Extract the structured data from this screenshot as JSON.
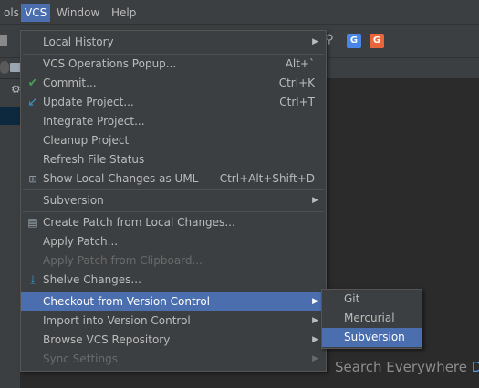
{
  "menubar": {
    "items": [
      {
        "label": "ols",
        "active": false
      },
      {
        "label": "VCS",
        "active": true
      },
      {
        "label": "Window",
        "active": false
      },
      {
        "label": "Help",
        "active": false
      }
    ]
  },
  "search_hint": {
    "text": "Search Everywhere",
    "key": "D"
  },
  "vcs_menu": {
    "local_history": "Local History",
    "operations_popup": "VCS Operations Popup...",
    "operations_popup_shortcut": "Alt+`",
    "commit": "Commit...",
    "commit_shortcut": "Ctrl+K",
    "update_project": "Update Project...",
    "update_project_shortcut": "Ctrl+T",
    "integrate_project": "Integrate Project...",
    "cleanup_project": "Cleanup Project",
    "refresh_file_status": "Refresh File Status",
    "show_local_changes": "Show Local Changes as UML",
    "show_local_changes_shortcut": "Ctrl+Alt+Shift+D",
    "subversion": "Subversion",
    "create_patch": "Create Patch from Local Changes...",
    "apply_patch": "Apply Patch...",
    "apply_patch_clipboard": "Apply Patch from Clipboard...",
    "shelve_changes": "Shelve Changes...",
    "checkout": "Checkout from Version Control",
    "import": "Import into Version Control",
    "browse_repo": "Browse VCS Repository",
    "sync_settings": "Sync Settings"
  },
  "checkout_submenu": {
    "git": "Git",
    "mercurial": "Mercurial",
    "subversion": "Subversion"
  },
  "colors": {
    "accent": "#4b6eaf",
    "menu_bg": "#3c3f41",
    "text": "#bbbbbb",
    "disabled_text": "#6a6a6a"
  }
}
